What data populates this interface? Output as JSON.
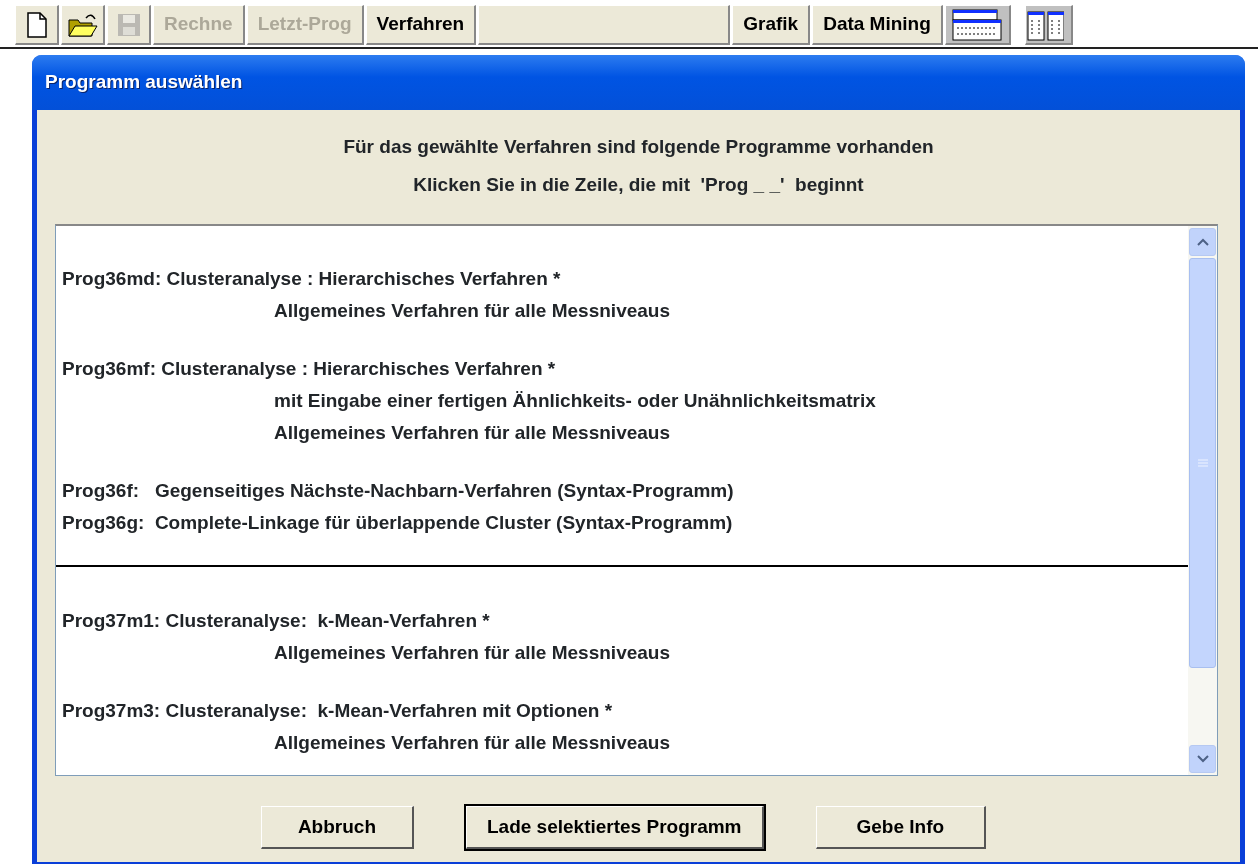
{
  "toolbar": {
    "items": [
      {
        "kind": "new",
        "disabled": false
      },
      {
        "kind": "open",
        "disabled": false
      },
      {
        "kind": "save",
        "disabled": true
      },
      {
        "kind": "button",
        "label": "Rechne",
        "disabled": true
      },
      {
        "kind": "button",
        "label": "Letzt-Prog",
        "disabled": true
      },
      {
        "kind": "button",
        "label": "Verfahren",
        "disabled": false
      },
      {
        "kind": "spacer"
      },
      {
        "kind": "button",
        "label": "Grafik",
        "disabled": false
      },
      {
        "kind": "button",
        "label": "Data Mining",
        "disabled": false
      },
      {
        "kind": "keyboard"
      },
      {
        "kind": "table"
      }
    ]
  },
  "dialog": {
    "title": "Programm auswählen",
    "instructions": [
      "Für das gewählte Verfahren sind folgende Programme vorhanden",
      "Klicken Sie in die Zeile, die mit  'Prog _ _'  beginnt"
    ],
    "list": {
      "sections": [
        {
          "groups": [
            {
              "entries": [
                {
                  "heading": "Prog36md: Clusteranalyse : Hierarchisches Verfahren *",
                  "details": [
                    "Allgemeines Verfahren für alle Messniveaus"
                  ]
                }
              ]
            },
            {
              "entries": [
                {
                  "heading": "Prog36mf: Clusteranalyse : Hierarchisches Verfahren *",
                  "details": [
                    "mit Eingabe einer fertigen Ähnlichkeits- oder Unähnlichkeitsmatrix",
                    "Allgemeines Verfahren für alle Messniveaus"
                  ]
                }
              ]
            },
            {
              "entries": [
                {
                  "heading": "Prog36f:   Gegenseitiges Nächste-Nachbarn-Verfahren (Syntax-Programm)"
                },
                {
                  "heading": "Prog36g:  Complete-Linkage für überlappende Cluster (Syntax-Programm)"
                }
              ]
            }
          ]
        },
        {
          "groups": [
            {
              "entries": [
                {
                  "heading": "Prog37m1: Clusteranalyse:  k-Mean-Verfahren *",
                  "details": [
                    "Allgemeines Verfahren für alle Messniveaus"
                  ]
                }
              ]
            },
            {
              "entries": [
                {
                  "heading": "Prog37m3: Clusteranalyse:  k-Mean-Verfahren mit Optionen *",
                  "details": [
                    "Allgemeines Verfahren für alle Messniveaus"
                  ]
                }
              ]
            }
          ]
        }
      ]
    },
    "buttons": [
      {
        "label": "Abbruch",
        "default": false
      },
      {
        "label": "Lade selektiertes Programm",
        "default": true
      },
      {
        "label": "Gebe Info",
        "default": false
      }
    ]
  }
}
